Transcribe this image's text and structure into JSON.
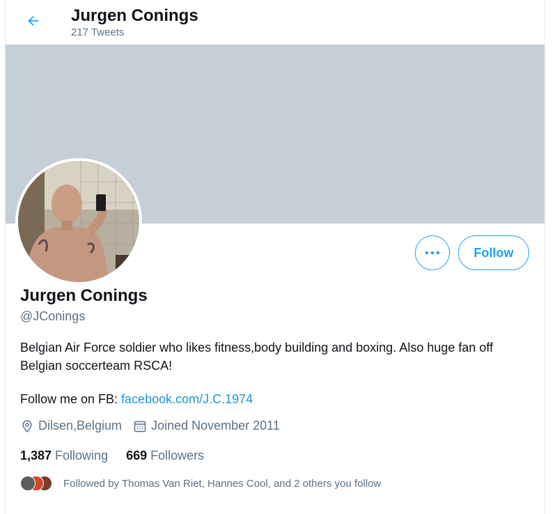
{
  "header": {
    "back_icon": "arrow-left-icon",
    "name": "Jurgen Conings",
    "tweet_count": "217 Tweets"
  },
  "colors": {
    "accent": "#1da1f2",
    "banner": "#c4cfd6",
    "secondary_text": "#5b7083"
  },
  "profile": {
    "name": "Jurgen Conings",
    "handle": "@JConings",
    "bio": "Belgian Air Force soldier who likes fitness,body building and boxing. Also huge fan off Belgian soccerteam RSCA!",
    "fb_prefix": "Follow me on FB: ",
    "fb_link": "facebook.com/J.C.1974",
    "location": "Dilsen,Belgium",
    "joined": "Joined November 2011",
    "following_count": "1,387",
    "following_label": "Following",
    "followers_count": "669",
    "followers_label": "Followers",
    "followed_by": "Followed by Thomas Van Riet, Hannes Cool, and 2 others you follow"
  },
  "actions": {
    "more_icon": "more-dots-icon",
    "follow_label": "Follow"
  }
}
